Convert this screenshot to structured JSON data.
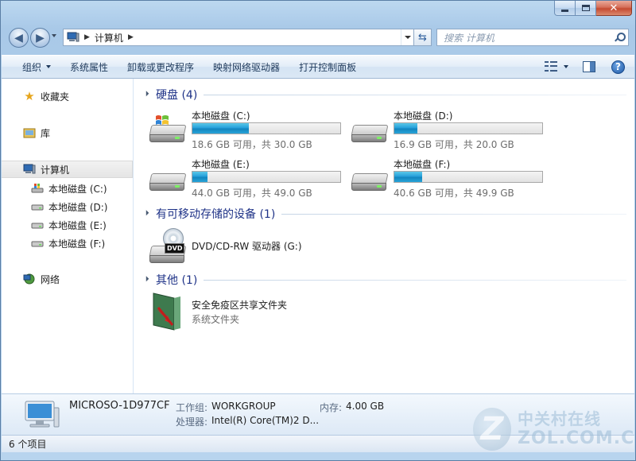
{
  "window": {
    "caption_buttons": [
      "minimize",
      "maximize",
      "close"
    ]
  },
  "address_bar": {
    "location_icon": "computer-icon",
    "crumbs": [
      "计算机"
    ],
    "refresh_icon": "refresh-icon"
  },
  "search": {
    "placeholder": "搜索 计算机"
  },
  "toolbar": {
    "organize_label": "组织",
    "system_properties_label": "系统属性",
    "uninstall_label": "卸载或更改程序",
    "map_drive_label": "映射网络驱动器",
    "control_panel_label": "打开控制面板"
  },
  "sidebar": {
    "favorites_label": "收藏夹",
    "libraries_label": "库",
    "computer_label": "计算机",
    "drives": [
      {
        "label": "本地磁盘 (C:)"
      },
      {
        "label": "本地磁盘 (D:)"
      },
      {
        "label": "本地磁盘 (E:)"
      },
      {
        "label": "本地磁盘 (F:)"
      }
    ],
    "network_label": "网络"
  },
  "groups": {
    "hard_disks": "硬盘 (4)",
    "removable": "有可移动存储的设备 (1)",
    "other": "其他 (1)"
  },
  "drives": [
    {
      "name": "本地磁盘 (C:)",
      "space": "18.6 GB 可用，共 30.0 GB",
      "used_fraction": 0.38,
      "system": true
    },
    {
      "name": "本地磁盘 (D:)",
      "space": "16.9 GB 可用，共 20.0 GB",
      "used_fraction": 0.155,
      "system": false
    },
    {
      "name": "本地磁盘 (E:)",
      "space": "44.0 GB 可用，共 49.0 GB",
      "used_fraction": 0.1,
      "system": false
    },
    {
      "name": "本地磁盘 (F:)",
      "space": "40.6 GB 可用，共 49.9 GB",
      "used_fraction": 0.19,
      "system": false
    }
  ],
  "removable": {
    "name": "DVD/CD-RW 驱动器 (G:)",
    "icon_text": "DVD"
  },
  "other": {
    "name": "安全免疫区共享文件夹",
    "sub": "系统文件夹"
  },
  "details": {
    "computer_name": "MICROSO-1D977CF",
    "workgroup_label": "工作组:",
    "workgroup_value": "WORKGROUP",
    "memory_label": "内存:",
    "memory_value": "4.00 GB",
    "cpu_label": "处理器:",
    "cpu_value": "Intel(R) Core(TM)2 D..."
  },
  "status": {
    "item_count": "6 个项目"
  },
  "watermark": {
    "cn": "中关村在线",
    "en": "ZOL.COM.CN"
  },
  "colors": {
    "accent": "#26a0da",
    "group_header": "#1e3287"
  }
}
